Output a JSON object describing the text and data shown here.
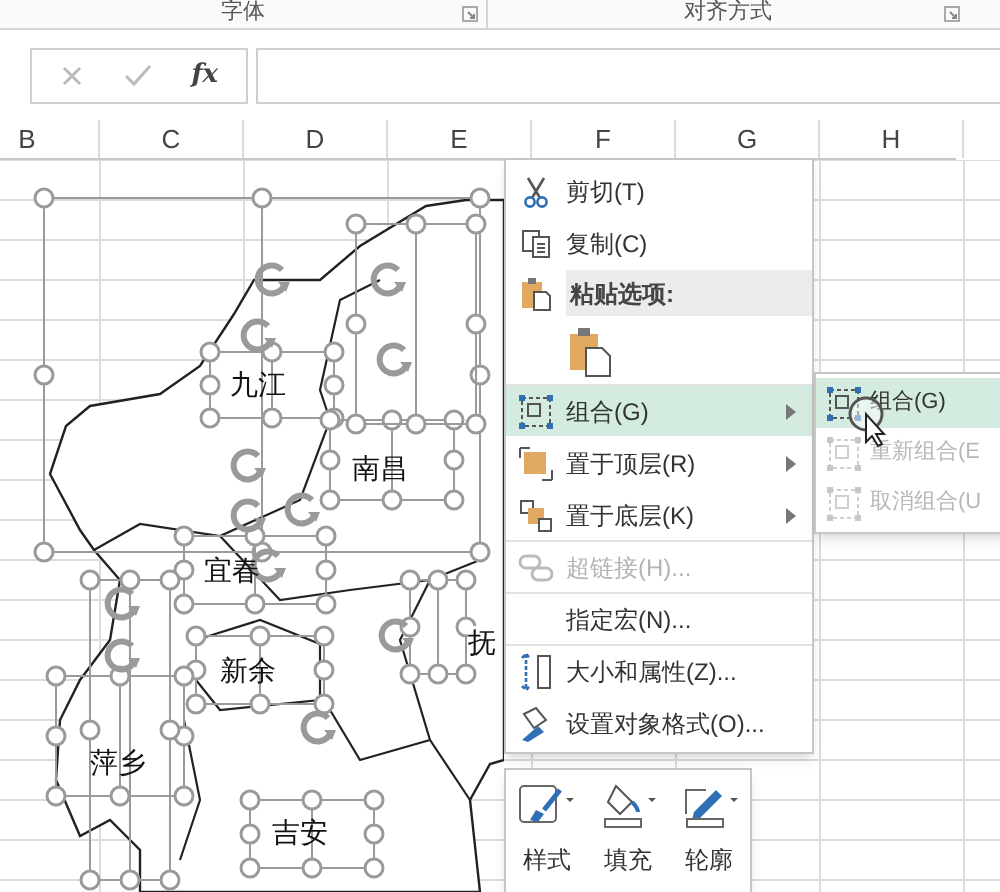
{
  "ribbon": {
    "groups": [
      {
        "label": "字体"
      },
      {
        "label": "对齐方式"
      }
    ]
  },
  "formula_bar": {
    "function_label": "fx"
  },
  "columns": [
    "B",
    "C",
    "D",
    "E",
    "F",
    "G",
    "H"
  ],
  "map": {
    "labels": [
      {
        "text": "九江"
      },
      {
        "text": "南昌"
      },
      {
        "text": "宜春"
      },
      {
        "text": "新余"
      },
      {
        "text": "萍乡"
      },
      {
        "text": "吉安"
      },
      {
        "text": "抚"
      }
    ]
  },
  "context_menu": {
    "items": [
      {
        "kind": "command",
        "label": "剪切(T)",
        "disabled": false,
        "selected": false,
        "submenu": false,
        "divider_before": false
      },
      {
        "kind": "command",
        "label": "复制(C)",
        "disabled": false,
        "selected": false,
        "submenu": false,
        "divider_before": false
      },
      {
        "kind": "header",
        "label": "粘贴选项:"
      },
      {
        "kind": "paste"
      },
      {
        "kind": "command",
        "label": "组合(G)",
        "disabled": false,
        "selected": true,
        "submenu": true,
        "divider_before": true
      },
      {
        "kind": "command",
        "label": "置于顶层(R)",
        "disabled": false,
        "selected": false,
        "submenu": true,
        "divider_before": false
      },
      {
        "kind": "command",
        "label": "置于底层(K)",
        "disabled": false,
        "selected": false,
        "submenu": true,
        "divider_before": false
      },
      {
        "kind": "command",
        "label": "超链接(H)...",
        "disabled": true,
        "selected": false,
        "submenu": false,
        "divider_before": true
      },
      {
        "kind": "command",
        "label": "指定宏(N)...",
        "disabled": false,
        "selected": false,
        "submenu": false,
        "divider_before": true
      },
      {
        "kind": "command",
        "label": "大小和属性(Z)...",
        "disabled": false,
        "selected": false,
        "submenu": false,
        "divider_before": true
      },
      {
        "kind": "command",
        "label": "设置对象格式(O)...",
        "disabled": false,
        "selected": false,
        "submenu": false,
        "divider_before": false
      }
    ]
  },
  "submenu": {
    "items": [
      {
        "label": "组合(G)",
        "disabled": false,
        "selected": true
      },
      {
        "label": "重新组合(E",
        "disabled": true,
        "selected": false
      },
      {
        "label": "取消组合(U",
        "disabled": true,
        "selected": false
      }
    ]
  },
  "mini_toolbar": {
    "buttons": [
      {
        "label": "样式"
      },
      {
        "label": "填充"
      },
      {
        "label": "轮廓"
      }
    ]
  }
}
